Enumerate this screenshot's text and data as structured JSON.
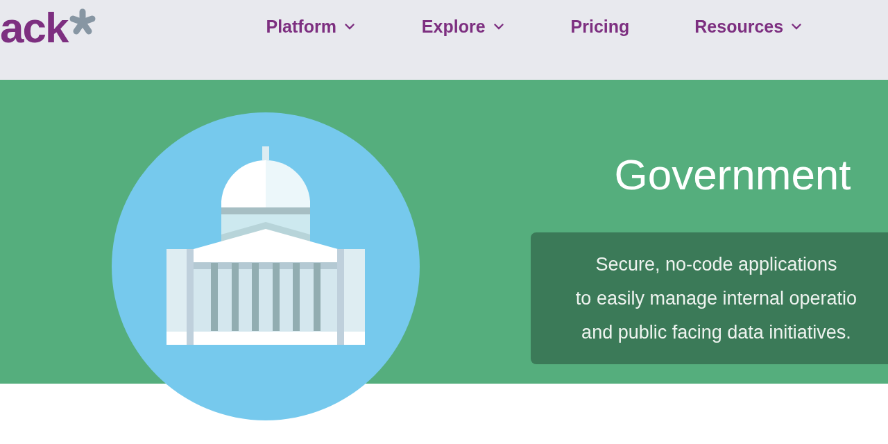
{
  "header": {
    "logo": "ack",
    "nav": [
      {
        "label": "Platform",
        "dropdown": true
      },
      {
        "label": "Explore",
        "dropdown": true
      },
      {
        "label": "Pricing",
        "dropdown": false
      },
      {
        "label": "Resources",
        "dropdown": true
      }
    ]
  },
  "hero": {
    "title": "Government",
    "description_lines": [
      "Secure, no-code applications",
      "to easily manage internal operatio",
      "and public facing data initiatives."
    ]
  }
}
